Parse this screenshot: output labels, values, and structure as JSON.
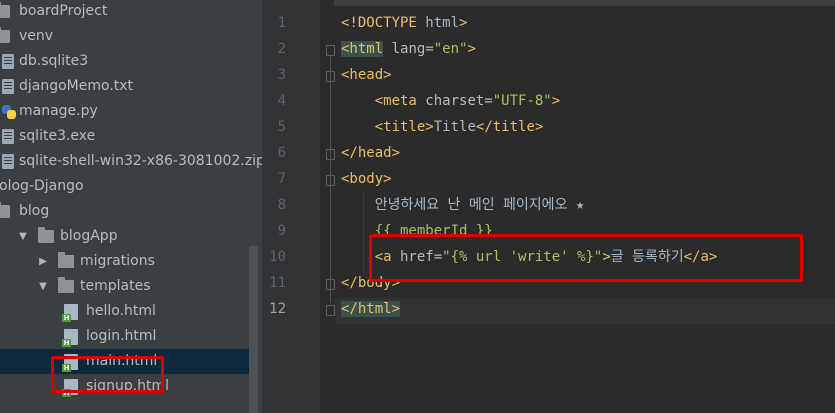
{
  "project_tree": [
    {
      "label": "boardProject",
      "type": "folder",
      "indent": 0
    },
    {
      "label": "venv",
      "type": "folder",
      "indent": 0
    },
    {
      "label": "db.sqlite3",
      "type": "file",
      "indent": 0
    },
    {
      "label": "djangoMemo.txt",
      "type": "file",
      "indent": 0
    },
    {
      "label": "manage.py",
      "type": "python",
      "indent": 0
    },
    {
      "label": "sqlite3.exe",
      "type": "file",
      "indent": 0
    },
    {
      "label": "sqlite-shell-win32-x86-3081002.zip",
      "type": "file",
      "indent": 0
    },
    {
      "label": "olog-Django",
      "type": "text",
      "indent": 0
    },
    {
      "label": "blog",
      "type": "folder",
      "indent": 0
    },
    {
      "label": "blogApp",
      "type": "folder",
      "indent": 1,
      "expanded": true
    },
    {
      "label": "migrations",
      "type": "folder",
      "indent": 2,
      "expanded": false
    },
    {
      "label": "templates",
      "type": "folder",
      "indent": 2,
      "expanded": true
    },
    {
      "label": "hello.html",
      "type": "html",
      "indent": 3
    },
    {
      "label": "login.html",
      "type": "html",
      "indent": 3
    },
    {
      "label": "main.html",
      "type": "html",
      "indent": 3,
      "selected": true
    },
    {
      "label": "signup.html",
      "type": "html",
      "indent": 3
    }
  ],
  "editor": {
    "current_line": 12,
    "line_numbers": [
      "1",
      "2",
      "3",
      "4",
      "5",
      "6",
      "7",
      "8",
      "9",
      "10",
      "11",
      "12"
    ],
    "code": [
      "<!DOCTYPE html>",
      "<html lang=\"en\">",
      "<head>",
      "    <meta charset=\"UTF-8\">",
      "    <title>Title</title>",
      "</head>",
      "<body>",
      "    안녕하세요 난 메인 페이지에오 ★",
      "    {{ memberId }}",
      "    <a href=\"{% url 'write' %}\">글 등록하기</a>",
      "</body>",
      "</html>"
    ],
    "highlighted_line": 10
  },
  "colors": {
    "tag": "#e8bf6a",
    "attr": "#bababa",
    "string": "#a5c261",
    "text": "#a9b7c6",
    "annotation_box": "#e00000",
    "selection": "#0d293e"
  }
}
